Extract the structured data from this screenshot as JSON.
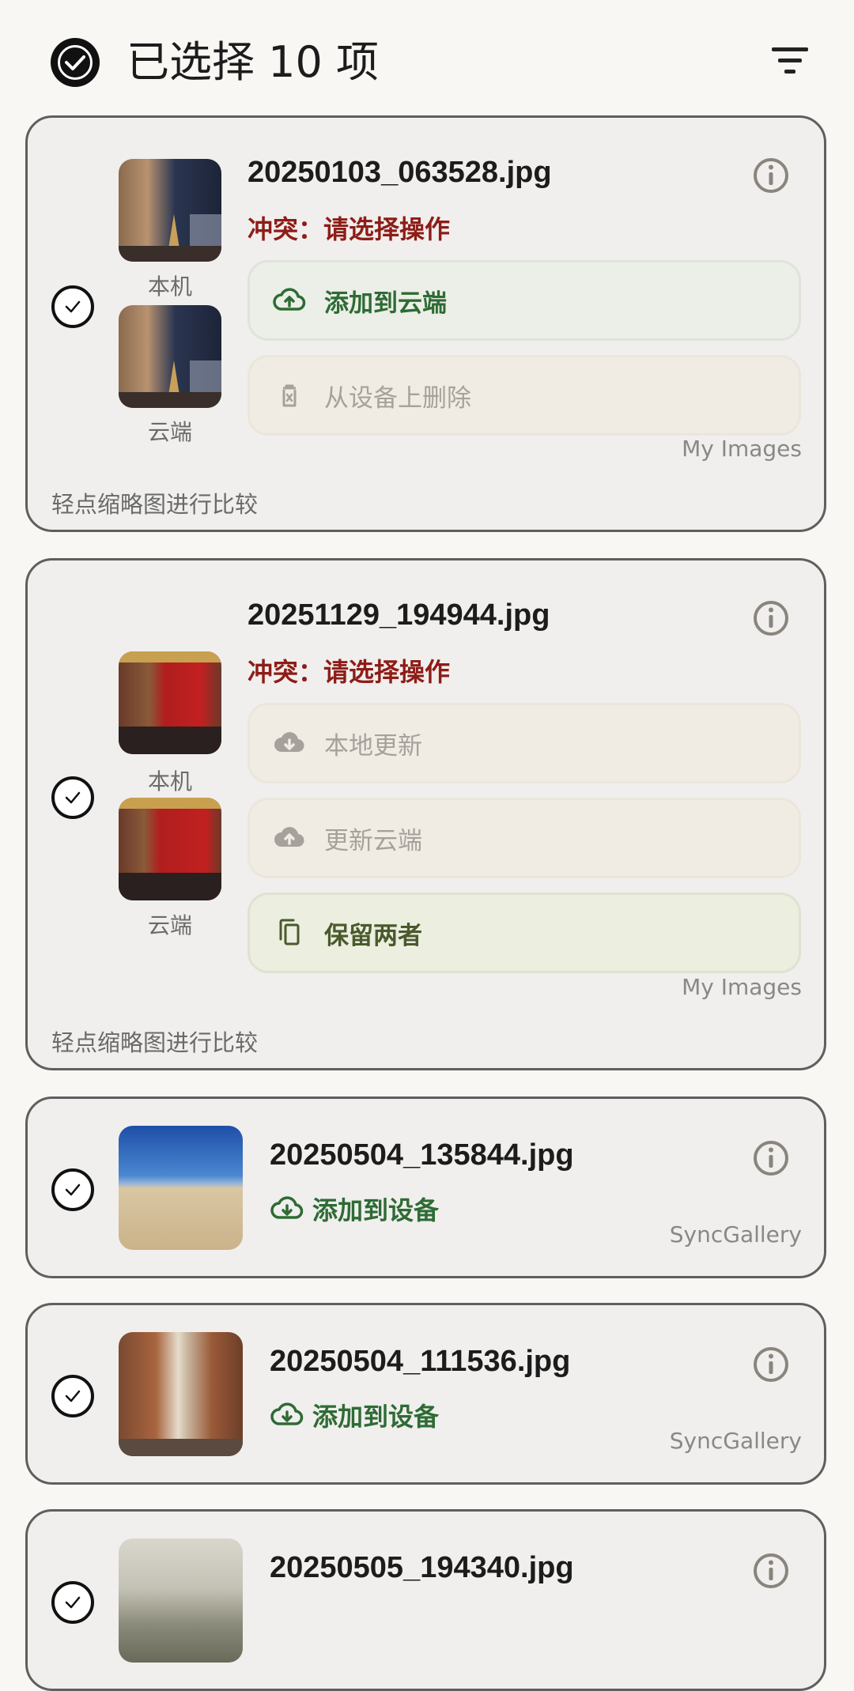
{
  "header": {
    "title": "已选择 10 项"
  },
  "items": [
    {
      "filename": "20250103_063528.jpg",
      "status": "冲突：请选择操作",
      "local_label": "本机",
      "cloud_label": "云端",
      "actions": [
        {
          "label": "添加到云端",
          "state": "active",
          "icon": "cloud-upload-icon"
        },
        {
          "label": "从设备上删除",
          "state": "disabled",
          "icon": "trash-icon"
        }
      ],
      "folder": "My Images",
      "hint": "轻点缩略图进行比较"
    },
    {
      "filename": "20251129_194944.jpg",
      "status": "冲突：请选择操作",
      "local_label": "本机",
      "cloud_label": "云端",
      "actions": [
        {
          "label": "本地更新",
          "state": "disabled",
          "icon": "cloud-download-icon"
        },
        {
          "label": "更新云端",
          "state": "disabled",
          "icon": "cloud-upload-icon"
        },
        {
          "label": "保留两者",
          "state": "active",
          "icon": "copy-icon"
        }
      ],
      "folder": "My Images",
      "hint": "轻点缩略图进行比较"
    },
    {
      "filename": "20250504_135844.jpg",
      "action_label": "添加到设备",
      "folder": "SyncGallery"
    },
    {
      "filename": "20250504_111536.jpg",
      "action_label": "添加到设备",
      "folder": "SyncGallery"
    },
    {
      "filename": "20250505_194340.jpg"
    }
  ],
  "colors": {
    "background": "#f8f7f4",
    "card": "#f0efed",
    "conflict": "#8e1c17",
    "green": "#2e6b35",
    "disabled_text": "#a6a29b"
  }
}
